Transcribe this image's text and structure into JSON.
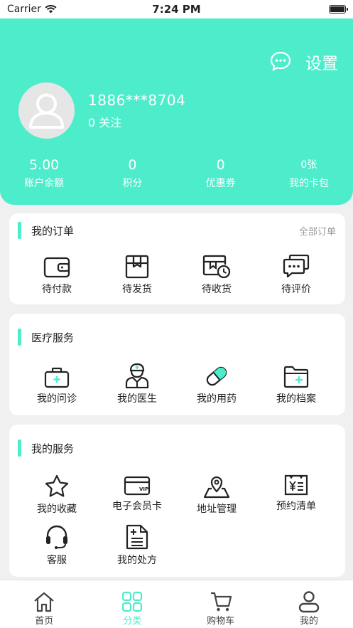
{
  "status_bar": {
    "carrier": "Carrier",
    "time": "7:24 PM",
    "battery_level": 1.0
  },
  "header": {
    "settings_label": "设置",
    "phone": "1886***8704",
    "follow": "0 关注",
    "stats": [
      {
        "value": "5.00",
        "label": "账户余额"
      },
      {
        "value": "0",
        "label": "积分"
      },
      {
        "value": "0",
        "label": "优惠券"
      },
      {
        "value": "0张",
        "label": "我的卡包"
      }
    ]
  },
  "orders": {
    "title": "我的订单",
    "more": "全部订单",
    "items": [
      {
        "label": "待付款",
        "icon": "wallet-icon"
      },
      {
        "label": "待发货",
        "icon": "package-icon"
      },
      {
        "label": "待收货",
        "icon": "delivery-clock-icon"
      },
      {
        "label": "待评价",
        "icon": "comment-icon"
      }
    ]
  },
  "medical": {
    "title": "医疗服务",
    "items": [
      {
        "label": "我的问诊",
        "icon": "medical-kit-icon"
      },
      {
        "label": "我的医生",
        "icon": "doctor-icon"
      },
      {
        "label": "我的用药",
        "icon": "pill-icon"
      },
      {
        "label": "我的档案",
        "icon": "folder-plus-icon"
      }
    ]
  },
  "services": {
    "title": "我的服务",
    "items": [
      {
        "label": "我的收藏",
        "icon": "star-icon"
      },
      {
        "label": "电子会员卡",
        "icon": "vip-card-icon"
      },
      {
        "label": "地址管理",
        "icon": "map-pin-icon"
      },
      {
        "label": "预约清单",
        "icon": "receipt-icon"
      },
      {
        "label": "客服",
        "icon": "headset-icon"
      },
      {
        "label": "我的处方",
        "icon": "prescription-icon"
      }
    ]
  },
  "tabbar": {
    "accent_color": "#4deccb",
    "active_index": 1,
    "tabs": [
      {
        "label": "首页",
        "icon": "home-icon"
      },
      {
        "label": "分类",
        "icon": "grid-icon"
      },
      {
        "label": "购物车",
        "icon": "cart-icon"
      },
      {
        "label": "我的",
        "icon": "user-icon"
      }
    ]
  }
}
